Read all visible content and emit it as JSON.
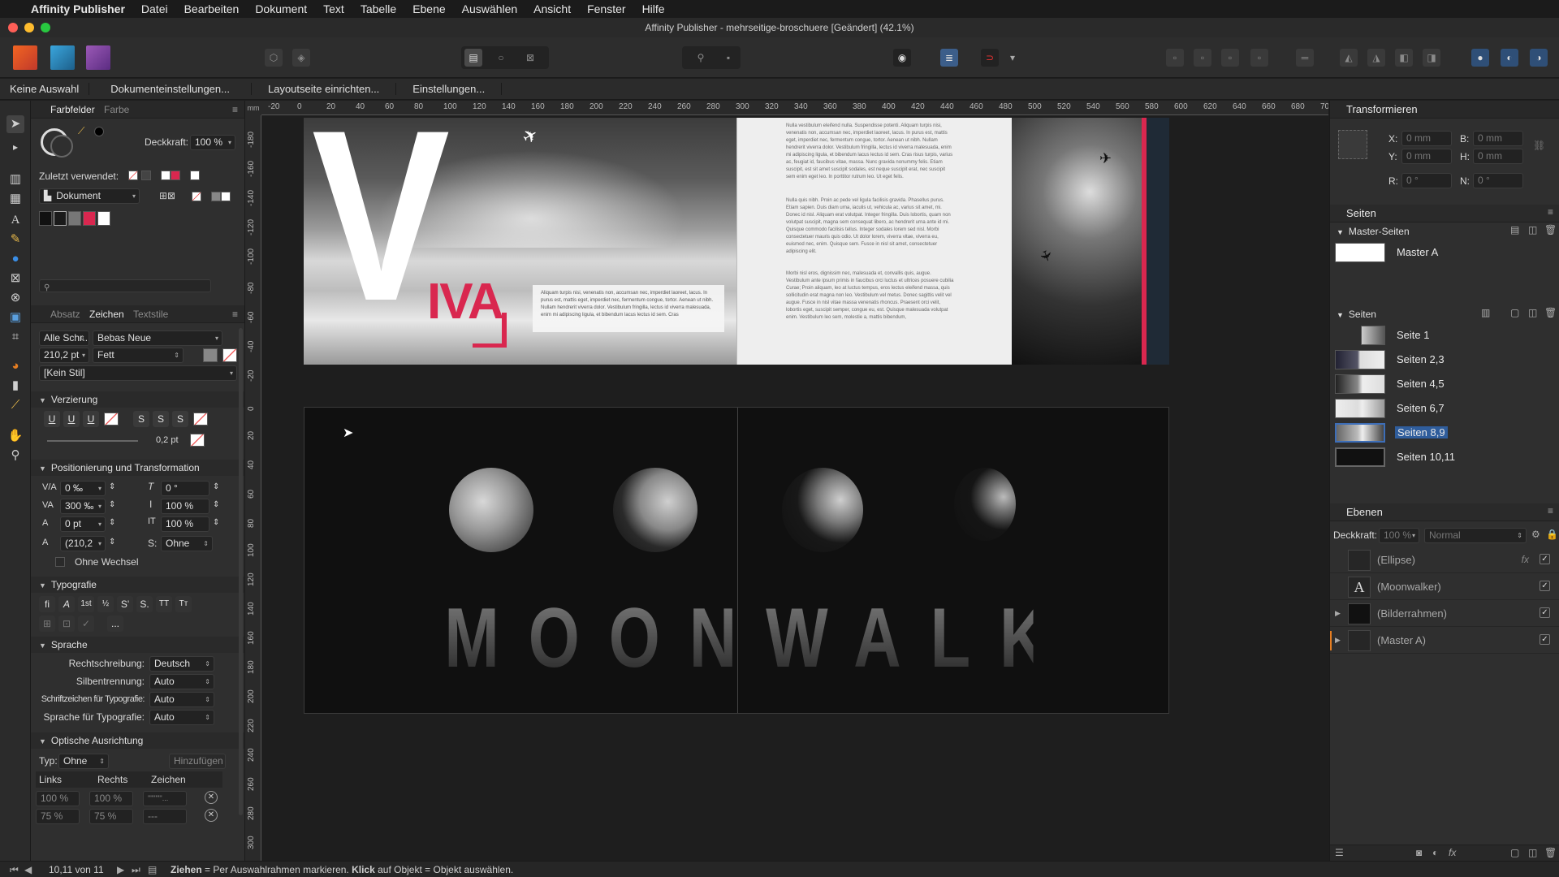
{
  "menubar": {
    "app_name": "Affinity Publisher",
    "items": [
      "Datei",
      "Bearbeiten",
      "Dokument",
      "Text",
      "Tabelle",
      "Ebene",
      "Auswählen",
      "Ansicht",
      "Fenster",
      "Hilfe"
    ]
  },
  "window": {
    "title": "Affinity Publisher - mehrseitige-broschuere [Geändert] (42.1%)"
  },
  "context": {
    "no_selection": "Keine Auswahl",
    "doc_settings": "Dokumenteinstellungen...",
    "layout_page": "Layoutseite einrichten...",
    "settings": "Einstellungen..."
  },
  "left": {
    "swatch_tabs": {
      "active": "Farbfelder",
      "other": "Farbe"
    },
    "opacity_label": "Deckkraft:",
    "opacity_value": "100 %",
    "recent_label": "Zuletzt verwendet:",
    "palette": "Dokument",
    "char_tabs": [
      "Absatz",
      "Zeichen",
      "Textstile"
    ],
    "font_collection": "Alle Schr...",
    "font_family": "Bebas Neue",
    "font_size": "210,2 pt",
    "font_style": "Fett",
    "char_style": "[Kein Stil]",
    "decoration": {
      "title": "Verzierung",
      "stroke": "0,2 pt",
      "buttons": [
        "U",
        "U",
        "U",
        "S",
        "S",
        "S"
      ]
    },
    "positioning": {
      "title": "Positionierung und Transformation",
      "kerning": "0 ‰",
      "italic_angle": "0 °",
      "tracking": "300 ‰",
      "vscale": "100 %",
      "baseline": "0 pt",
      "hscale": "100 %",
      "leading": "(210,2",
      "s_label": "S:",
      "s_value": "Ohne",
      "no_alt": "Ohne Wechsel"
    },
    "typography": {
      "title": "Typografie",
      "more": "..."
    },
    "language": {
      "title": "Sprache",
      "rows": [
        {
          "label": "Rechtschreibung:",
          "value": "Deutsch"
        },
        {
          "label": "Silbentrennung:",
          "value": "Auto"
        },
        {
          "label": "Schriftzeichen für Typografie:",
          "value": "Auto"
        },
        {
          "label": "Sprache für Typografie:",
          "value": "Auto"
        }
      ]
    },
    "optical": {
      "title": "Optische Ausrichtung",
      "type_label": "Typ:",
      "type_value": "Ohne",
      "add": "Hinzufügen",
      "cols": [
        "Links",
        "Rechts",
        "Zeichen"
      ],
      "row1": [
        "100 %",
        "100 %",
        "\"\"\"\"\"'..."
      ],
      "row2": [
        "75 %",
        "75 %",
        "---"
      ]
    }
  },
  "ruler": {
    "unit": "mm",
    "h_ticks": [
      "-20",
      "0",
      "20",
      "40",
      "60",
      "80",
      "100",
      "120",
      "140",
      "160",
      "180",
      "200",
      "220",
      "240",
      "260",
      "280",
      "300",
      "320",
      "340",
      "360",
      "380",
      "400",
      "420",
      "440",
      "460",
      "480",
      "500",
      "520",
      "540",
      "560",
      "580",
      "600",
      "620",
      "640",
      "660",
      "680",
      "70"
    ],
    "v_ticks": [
      "-180",
      "-160",
      "-140",
      "-120",
      "-100",
      "-80",
      "-60",
      "-40",
      "-20",
      "0",
      "20",
      "40",
      "60",
      "80",
      "100",
      "120",
      "140",
      "160",
      "180",
      "200",
      "220",
      "240",
      "260",
      "280",
      "300"
    ]
  },
  "spread1": {
    "big_letter": "V",
    "viva": "IVA",
    "caption": "Aliquam turpis nisi, venenatis non, accumsan nec, imperdiet laoreet, lacus. In purus est, mattis eget, imperdiet nec, fermentum congue, tortor. Aenean ut nibh. Nullam hendrerit viverra dolor. Vestibulum fringilla, lectus id viverra malesuada, enim mi adipiscing ligula, et bibendum lacus lectus id sem. Cras",
    "col1": "Nulla vestibulum eleifend nulla. Suspendisse potenti. Aliquam turpis nisi, venenatis non, accumsan nec, imperdiet laoreet, lacus. In purus est, mattis eget, imperdiet nec, fermentum congue, tortor. Aenean ut nibh. Nullam hendrerit viverra dolor. Vestibulum fringilla, lectus id viverra malesuada, enim mi adipiscing ligula, et bibendum lacus lectus id sem. Cras risus turpis, varius ac, feugiat id, faucibus vitae, massa. Nunc gravida nonummy felis. Etiam suscipit, est sit amet suscipit sodales, est neque suscipit erat, nec suscipit sem enim eget leo. In porttitor rutrum leo. Ut eget felis.",
    "col2": "Nulla quis nibh. Proin ac pede vel ligula facilisis gravida. Phasellus purus. Etiam sapien. Duis diam urna, iaculis ut, vehicula ac, varius sit amet, mi. Donec id nisl. Aliquam erat volutpat. Integer fringilla. Duis lobortis, quam non volutpat suscipit, magna sem consequat libero, ac hendrerit urna ante id mi. Quisque commodo facilisis tellus. Integer sodales lorem sed nisl. Morbi consectetuer mauris quis odio. Ut dolor lorem, viverra vitae, viverra eu, euismod nec, enim. Quisque sem. Fusce in nisl sit amet, consectetuer adipiscing elit.",
    "col3": "Morbi nisl eros, dignissim nec, malesuada et, convallis quis, augue. Vestibulum ante ipsum primis in faucibus orci luctus et ultrices posuere cubilia Curae; Proin aliquam, leo at luctus tempus, eros lectus eleifend massa, quis sollicitudin erat magna non leo. Vestibulum vel metus. Donec sagittis velit vel augue. Fusce in nisl vitae massa venenatis rhoncus. Praesent orci velit, lobortis eget, suscipit semper, congue eu, est. Quisque malesuada volutpat enim. Vestibulum leo sem, molestie a, mattis bibendum,"
  },
  "spread2": {
    "title": "MOONWALKER"
  },
  "right": {
    "transform_title": "Transformieren",
    "x": "0 mm",
    "y": "0 mm",
    "b": "0 mm",
    "h": "0 mm",
    "r": "0 °",
    "n": "0 °",
    "x_label": "X:",
    "y_label": "Y:",
    "b_label": "B:",
    "h_label": "H:",
    "r_label": "R:",
    "n_label": "N:",
    "pages_title": "Seiten",
    "master_title": "Master-Seiten",
    "master_a": "Master A",
    "pages_section": "Seiten",
    "pages": [
      "Seite 1",
      "Seiten 2,3",
      "Seiten 4,5",
      "Seiten 6,7",
      "Seiten 8,9",
      "Seiten 10,11"
    ],
    "layers_title": "Ebenen",
    "layer_opacity_label": "Deckkraft:",
    "layer_opacity": "100 %",
    "blend_mode": "Normal",
    "layers": [
      "(Ellipse)",
      "(Moonwalker)",
      "(Bilderrahmen)",
      "(Master A)"
    ]
  },
  "status": {
    "page": "10,11 von 11",
    "drag": "Ziehen",
    "drag_text": " = Per Auswahlrahmen markieren. ",
    "click": "Klick",
    "click_text": " auf Objekt = Objekt auswählen."
  },
  "colors": {
    "accent_red": "#d9274f",
    "selection_blue": "#2f5d9c",
    "panel_bg": "#2f2f2f"
  }
}
